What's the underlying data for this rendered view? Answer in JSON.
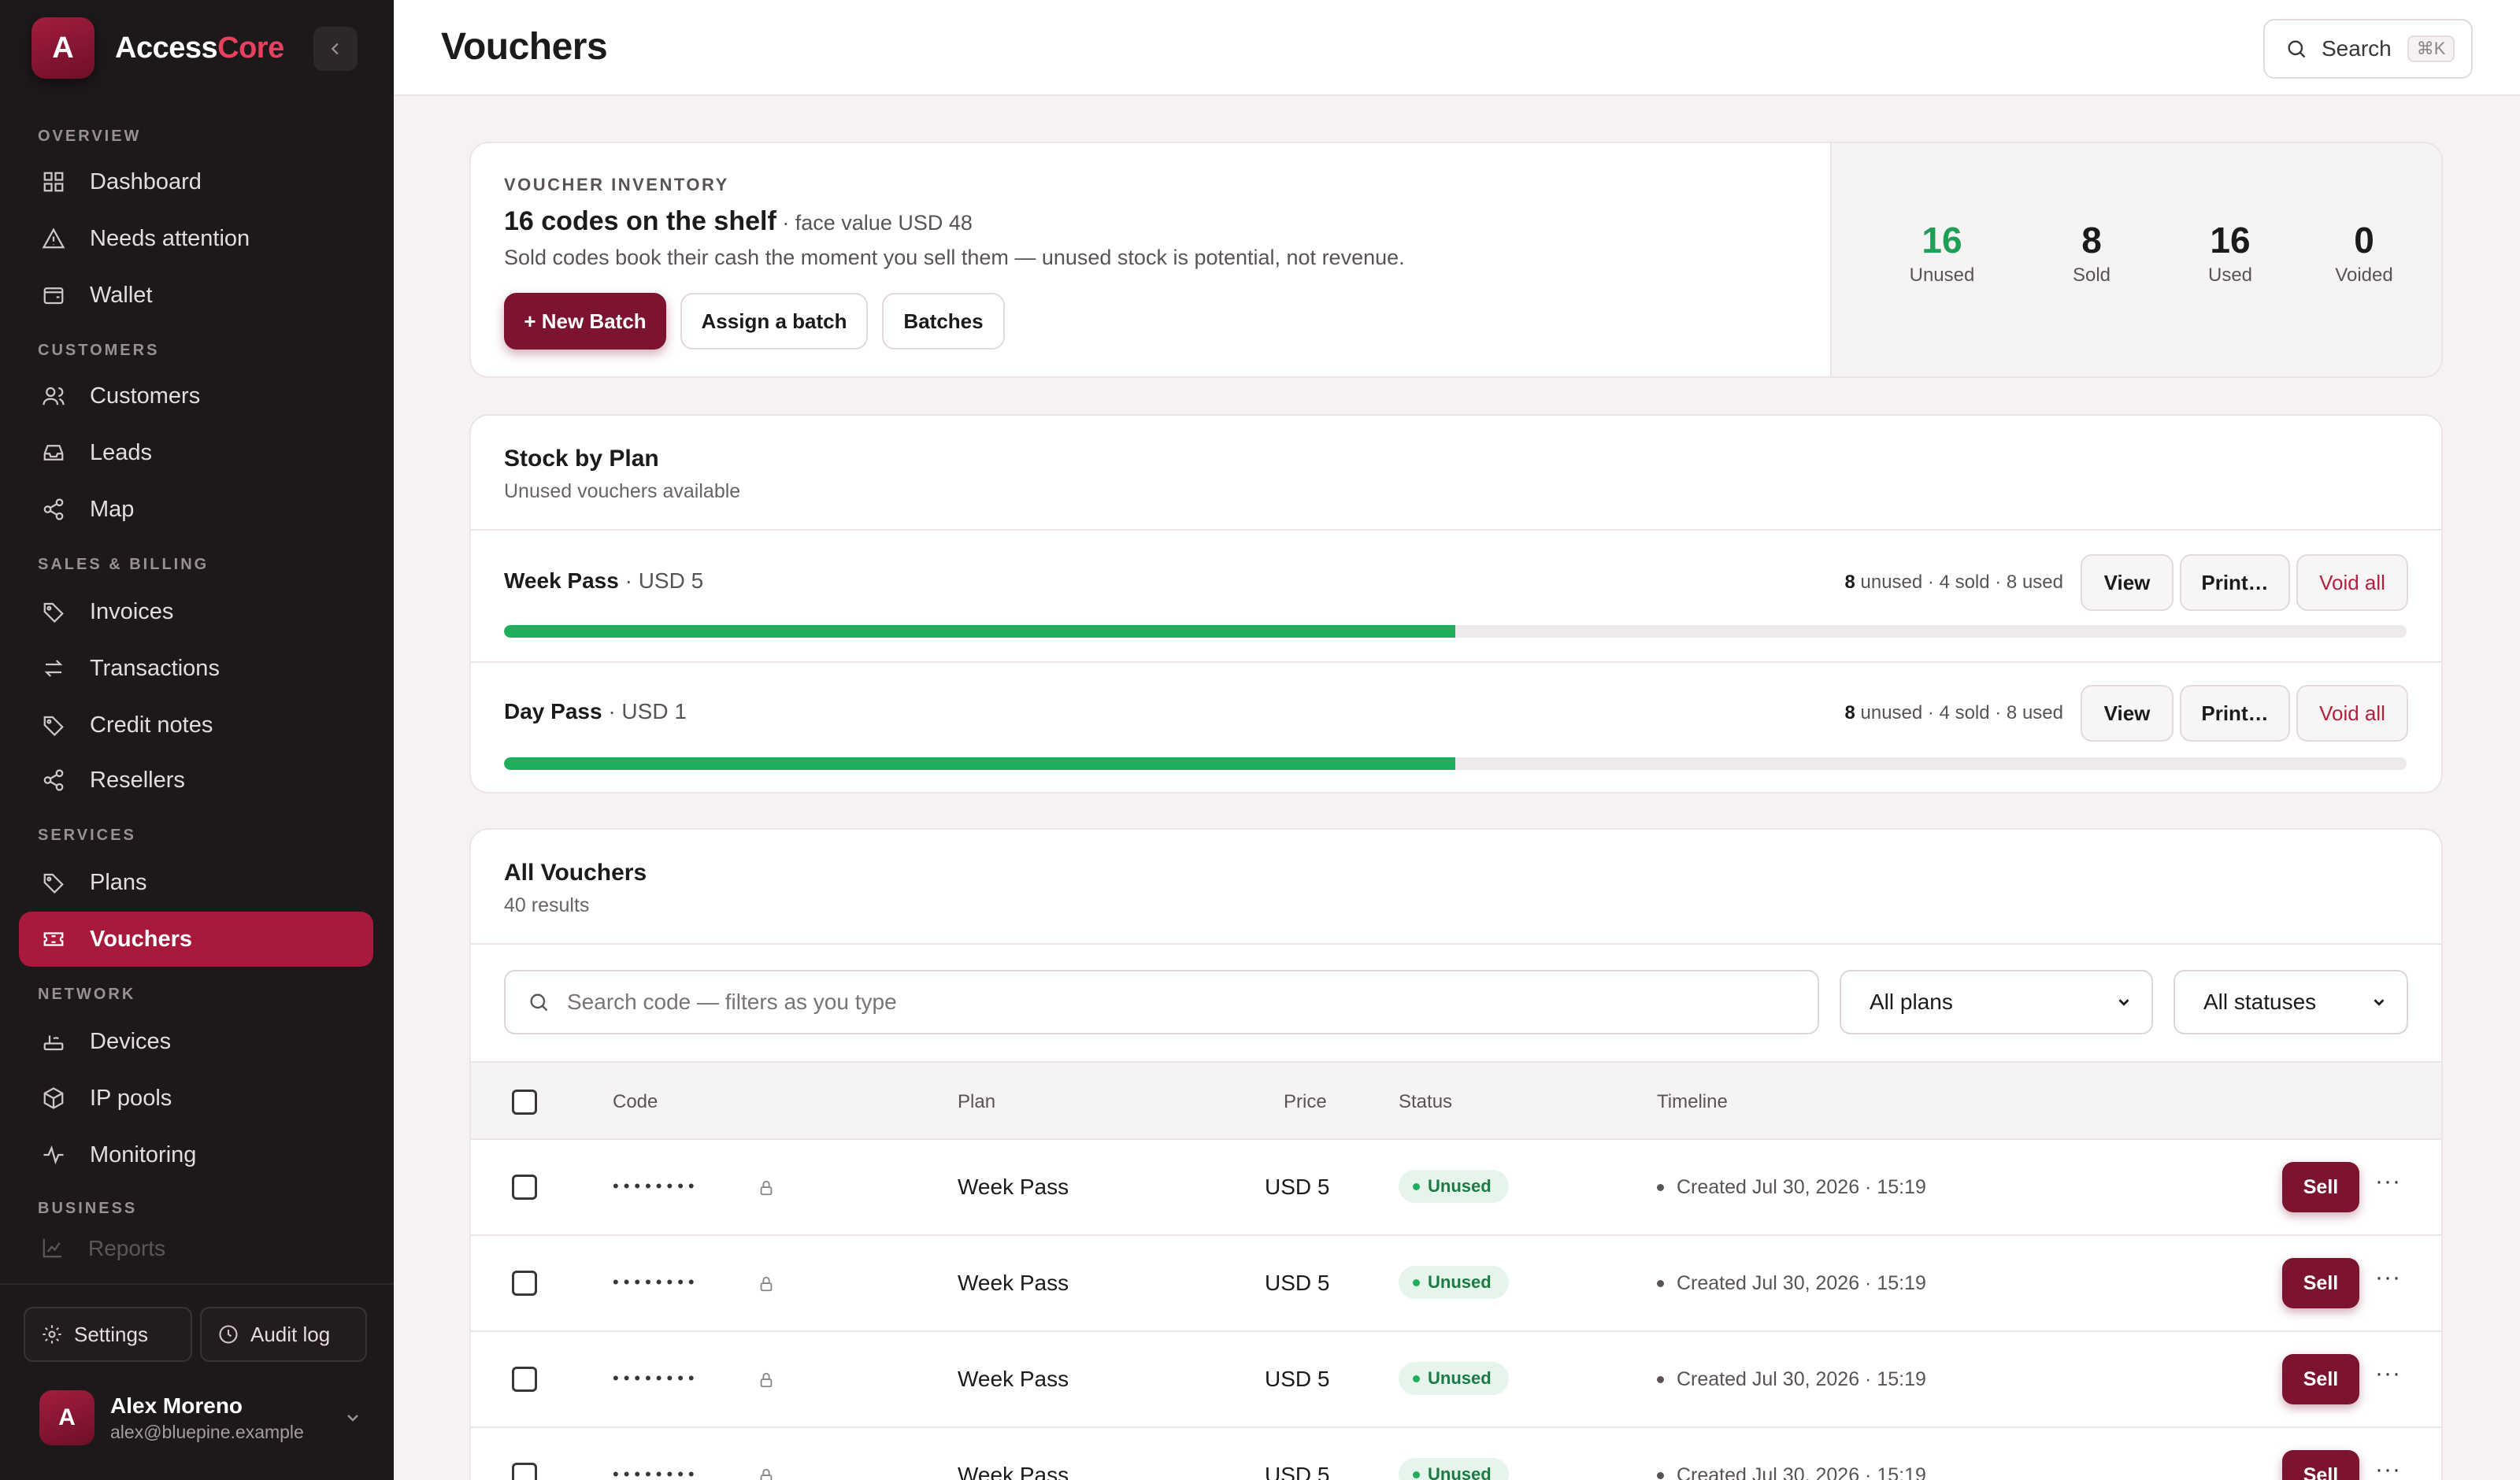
{
  "brand": {
    "name_main": "Access",
    "name_accent": "Core",
    "logo_letter": "A"
  },
  "sidebar": {
    "sections": {
      "overview": "OVERVIEW",
      "customers": "CUSTOMERS",
      "sales": "SALES & BILLING",
      "services": "SERVICES",
      "network": "NETWORK",
      "business": "BUSINESS"
    },
    "items": {
      "dashboard": "Dashboard",
      "needs_attention": "Needs attention",
      "wallet": "Wallet",
      "customers": "Customers",
      "leads": "Leads",
      "map": "Map",
      "invoices": "Invoices",
      "transactions": "Transactions",
      "credit_notes": "Credit notes",
      "resellers": "Resellers",
      "plans": "Plans",
      "vouchers": "Vouchers",
      "devices": "Devices",
      "ip_pools": "IP pools",
      "monitoring": "Monitoring",
      "reports": "Reports"
    },
    "footer": {
      "settings": "Settings",
      "audit_log": "Audit log"
    },
    "user": {
      "avatar_letter": "A",
      "name": "Alex Moreno",
      "email": "alex@bluepine.example"
    }
  },
  "header": {
    "title": "Vouchers",
    "search_label": "Search",
    "search_shortcut": "⌘K"
  },
  "inventory": {
    "eyebrow": "VOUCHER INVENTORY",
    "headline": "16 codes on the shelf",
    "headline_sub": " · face value USD 48",
    "description": "Sold codes book their cash the moment you sell them — unused stock is potential, not revenue.",
    "buttons": {
      "new_batch": "+ New Batch",
      "assign": "Assign a batch",
      "batches": "Batches"
    },
    "stats": [
      {
        "value": "16",
        "label": "Unused",
        "color": "#1f9e57"
      },
      {
        "value": "8",
        "label": "Sold",
        "color": "#1c1a1b"
      },
      {
        "value": "16",
        "label": "Used",
        "color": "#1c1a1b"
      },
      {
        "value": "0",
        "label": "Voided",
        "color": "#1c1a1b"
      }
    ]
  },
  "stock": {
    "title": "Stock by Plan",
    "subtitle": "Unused vouchers available",
    "plans": [
      {
        "name": "Week Pass",
        "price": " · USD 5",
        "unused": "8",
        "rest": " unused · 4 sold · 8 used",
        "fill_fraction": 0.5,
        "view": "View",
        "print": "Print…",
        "void": "Void all"
      },
      {
        "name": "Day Pass",
        "price": " · USD 1",
        "unused": "8",
        "rest": " unused · 4 sold · 8 used",
        "fill_fraction": 0.5,
        "view": "View",
        "print": "Print…",
        "void": "Void all"
      }
    ]
  },
  "all_vouchers": {
    "title": "All Vouchers",
    "subtitle": "40 results",
    "search_placeholder": "Search code — filters as you type",
    "plan_filter": "All plans",
    "status_filter": "All statuses",
    "columns": {
      "code": "Code",
      "plan": "Plan",
      "price": "Price",
      "status": "Status",
      "timeline": "Timeline"
    },
    "rows": [
      {
        "code": "••••••••",
        "plan": "Week Pass",
        "price": "USD 5",
        "status": "Unused",
        "timeline": "Created Jul 30, 2026 · 15:19",
        "action": "Sell"
      },
      {
        "code": "••••••••",
        "plan": "Week Pass",
        "price": "USD 5",
        "status": "Unused",
        "timeline": "Created Jul 30, 2026 · 15:19",
        "action": "Sell"
      },
      {
        "code": "••••••••",
        "plan": "Week Pass",
        "price": "USD 5",
        "status": "Unused",
        "timeline": "Created Jul 30, 2026 · 15:19",
        "action": "Sell"
      },
      {
        "code": "••••••••",
        "plan": "Week Pass",
        "price": "USD 5",
        "status": "Unused",
        "timeline": "Created Jul 30, 2026 · 15:19",
        "action": "Sell"
      }
    ]
  }
}
